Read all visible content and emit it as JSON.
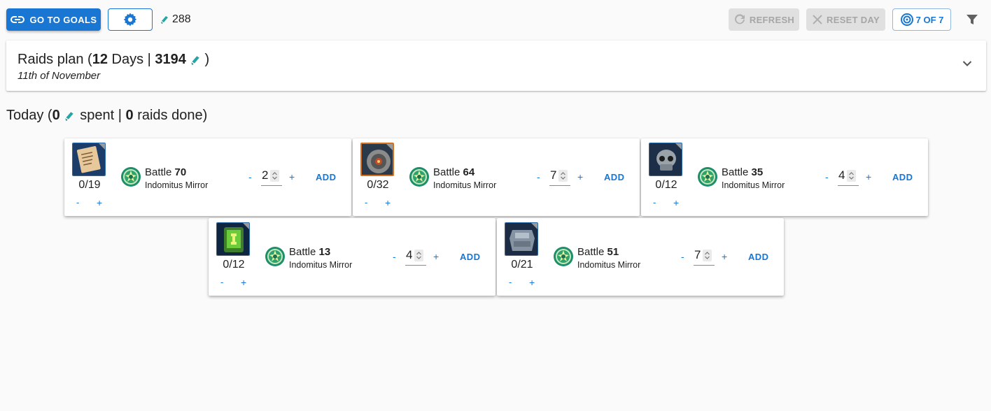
{
  "toolbar": {
    "goals_label": "GO TO GOALS",
    "energy_value": "288",
    "refresh_label": "REFRESH",
    "reset_label": "RESET DAY",
    "count_label": "7 OF 7"
  },
  "plan": {
    "title_prefix": "Raids plan (",
    "days": "12",
    "days_word": " Days | ",
    "energy_total": "3194",
    "title_suffix": " )",
    "date": "11th of November"
  },
  "today": {
    "prefix": "Today (",
    "energy_spent": "0",
    "spent_word": " spent | ",
    "raids_done": "0",
    "raids_word": " raids done)"
  },
  "raids": [
    {
      "battle_word": "Battle ",
      "battle_number": "70",
      "campaign": "Indomitus Mirror",
      "item_count": "0/19",
      "item_minus": "-",
      "item_plus": "+",
      "raid_count": "2",
      "raid_minus": "-",
      "raid_plus": "+",
      "add_label": "ADD",
      "item_icon": "scroll-icon"
    },
    {
      "battle_word": "Battle ",
      "battle_number": "64",
      "campaign": "Indomitus Mirror",
      "item_count": "0/32",
      "item_minus": "-",
      "item_plus": "+",
      "raid_count": "7",
      "raid_minus": "-",
      "raid_plus": "+",
      "add_label": "ADD",
      "item_icon": "gear-disc-icon"
    },
    {
      "battle_word": "Battle ",
      "battle_number": "35",
      "campaign": "Indomitus Mirror",
      "item_count": "0/12",
      "item_minus": "-",
      "item_plus": "+",
      "raid_count": "4",
      "raid_minus": "-",
      "raid_plus": "+",
      "add_label": "ADD",
      "item_icon": "skull-icon"
    },
    {
      "battle_word": "Battle ",
      "battle_number": "13",
      "campaign": "Indomitus Mirror",
      "item_count": "0/12",
      "item_minus": "-",
      "item_plus": "+",
      "raid_count": "4",
      "raid_minus": "-",
      "raid_plus": "+",
      "add_label": "ADD",
      "item_icon": "data-slate-icon"
    },
    {
      "battle_word": "Battle ",
      "battle_number": "51",
      "campaign": "Indomitus Mirror",
      "item_count": "0/21",
      "item_minus": "-",
      "item_plus": "+",
      "raid_count": "7",
      "raid_minus": "-",
      "raid_plus": "+",
      "add_label": "ADD",
      "item_icon": "armor-plate-icon"
    }
  ],
  "colors": {
    "primary": "#1976d2",
    "disabled_bg": "#e0e0e0",
    "disabled_text": "#a6a6a6",
    "energy": "#2aa3a3"
  }
}
